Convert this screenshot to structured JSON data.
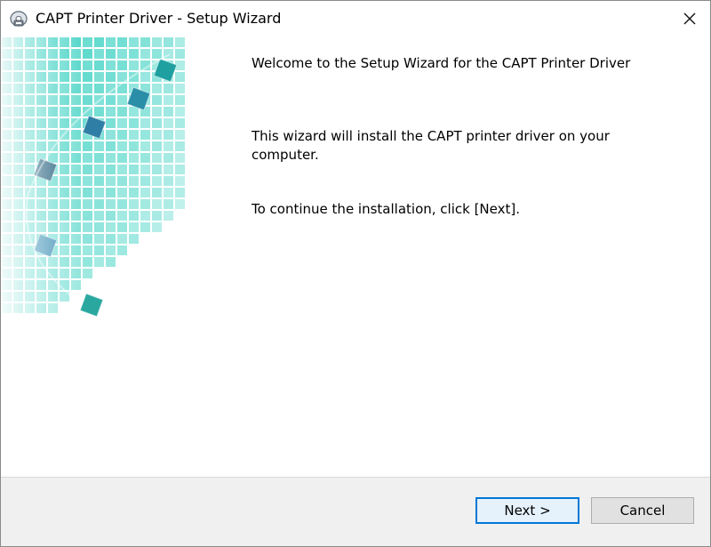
{
  "window": {
    "title": "CAPT Printer Driver - Setup Wizard"
  },
  "icons": {
    "app": "printer-disc-icon",
    "close": "close-icon"
  },
  "content": {
    "welcome": "Welcome to the Setup Wizard for the CAPT Printer Driver",
    "description": "This wizard will install the CAPT printer driver on your computer.",
    "instruction": "To continue the installation, click [Next]."
  },
  "buttons": {
    "next": "Next >",
    "cancel": "Cancel"
  },
  "colors": {
    "accent": "#0078d7",
    "banner_teal": "#2fc8b8",
    "footer_bg": "#f0f0f0"
  }
}
